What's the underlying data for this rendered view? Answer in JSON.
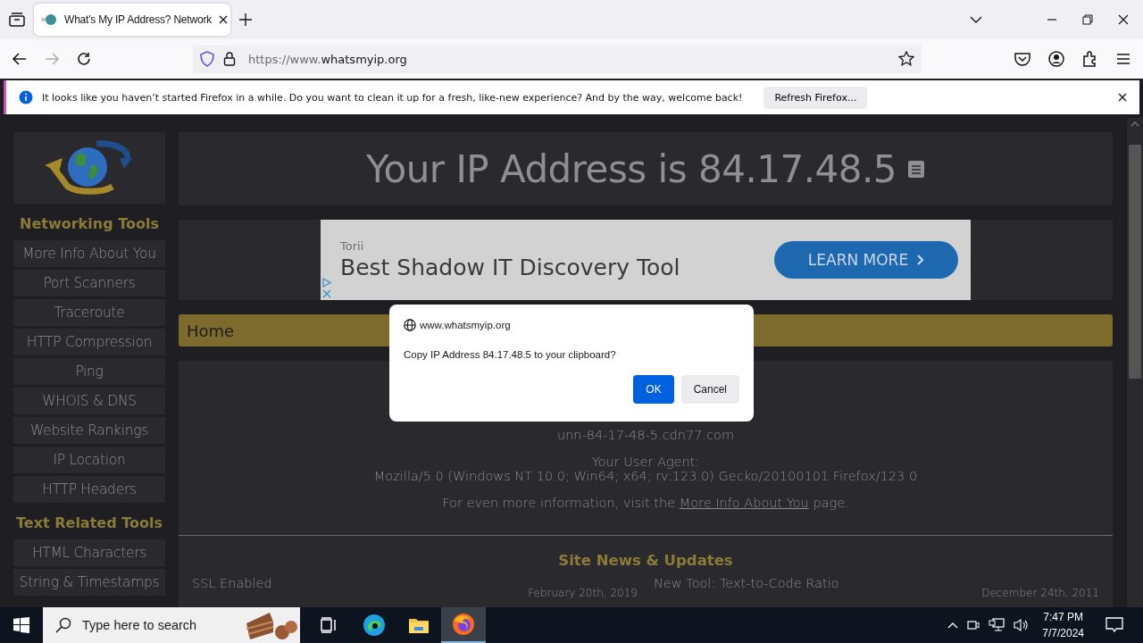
{
  "browser": {
    "tabs": [
      {
        "title": "What's My IP Address? Network",
        "selected": true
      }
    ],
    "url_prefix": "https://www.",
    "url_domain": "whatsmyip.org",
    "notification": {
      "message": "It looks like you haven’t started Firefox in a while. Do you want to clean it up for a fresh, like-new experience? And by the way, welcome back!",
      "button": "Refresh Firefox..."
    }
  },
  "page": {
    "sidebar": [
      {
        "heading": "Networking Tools",
        "items": [
          "More Info About You",
          "Port Scanners",
          "Traceroute",
          "HTTP Compression",
          "Ping",
          "WHOIS & DNS",
          "Website Rankings",
          "IP Location",
          "HTTP Headers"
        ]
      },
      {
        "heading": "Text Related Tools",
        "items": [
          "HTML Characters",
          "String & Timestamps"
        ]
      }
    ],
    "title": "Your IP Address is 84.17.48.5",
    "ad": {
      "brand": "Torii",
      "headline": "Best Shadow IT Discovery Tool",
      "button": "LEARN MORE"
    },
    "breadcrumb": "Home",
    "info": {
      "hostname": "unn-84-17-48-5.cdn77.com",
      "ua_label": "Your User Agent:",
      "user_agent": "Mozilla/5.0 (Windows NT 10.0; Win64; x64; rv:123.0) Gecko/20100101 Firefox/123.0",
      "more_before": "For even more information, visit the",
      "more_link": "More Info About You",
      "more_after": "page."
    },
    "news": {
      "title": "Site News & Updates",
      "items": [
        {
          "title": "SSL Enabled",
          "date": "February 20th, 2019"
        },
        {
          "title": "New Tool: Text-to-Code Ratio",
          "date": "December 24th, 2011"
        }
      ]
    }
  },
  "dialog": {
    "origin": "www.whatsmyip.org",
    "message": "Copy IP Address 84.17.48.5 to your clipboard?",
    "buttons": [
      {
        "label": "OK",
        "kind": "primary"
      },
      {
        "label": "Cancel",
        "kind": "secondary"
      }
    ]
  },
  "taskbar": {
    "search_placeholder": "Type here to search",
    "apps": [
      {
        "kind": "task-view",
        "selected": false
      },
      {
        "kind": "edge",
        "selected": false
      },
      {
        "kind": "explorer",
        "selected": false
      },
      {
        "kind": "firefox",
        "selected": true
      }
    ],
    "time": "7:47 PM",
    "date": "7/7/2024"
  }
}
